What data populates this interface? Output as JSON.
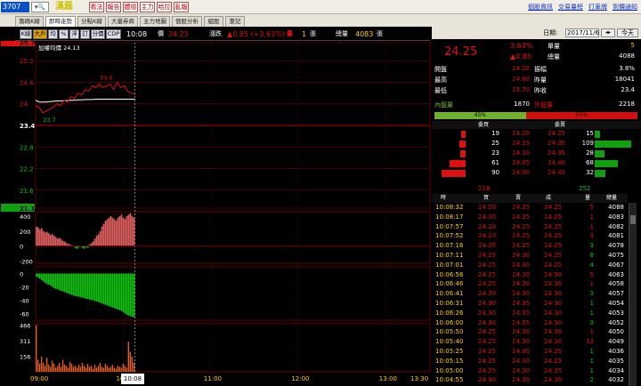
{
  "toolbar": {
    "stock_code": "3707",
    "stock_name": "漢磊",
    "buttons": [
      "看法",
      "報告",
      "體檢",
      "主力",
      "哈拉",
      "亂報"
    ],
    "links": [
      "個股資訊",
      "交易量榜",
      "打車牌",
      "到價通知"
    ]
  },
  "tabs": [
    "籌碼K線",
    "即時走勢",
    "分點K線",
    "大量券商",
    "主力地圖",
    "個股分析",
    "組股",
    "筆記"
  ],
  "active_tab": "即時走勢",
  "chartbar": {
    "buttons": [
      "K線",
      "大戶",
      "均",
      "%",
      "浮",
      "訂",
      "分價",
      "CDP"
    ],
    "on": [
      "大戶"
    ],
    "time": "10:08",
    "price_label": "價",
    "price": "24.25",
    "change_label": "漲跌",
    "change": "▲0.85 (+3.63%)",
    "vol_label": "量",
    "vol": "1",
    "vol_unit": "張",
    "total_label": "總量",
    "total": "4083",
    "total_unit": "張"
  },
  "chart": {
    "avg_label": "加權均價 24.13",
    "y_ticks": [
      "25.7",
      "25.2",
      "24.6",
      "24",
      "23.4",
      "22.8",
      "22.2",
      "21.6",
      "21.1"
    ],
    "high_mark": "24.6",
    "low_mark": "23.7",
    "big_ticks": [
      "400",
      "200",
      "0",
      "-200"
    ],
    "net_ticks": [
      "0",
      "-20",
      "-40",
      "-60"
    ],
    "vol_ticks": [
      "466",
      "311",
      "156"
    ],
    "time_ticks": [
      "09:00",
      "10",
      "11:00",
      "12:00",
      "13:00",
      "13:30"
    ],
    "cursor_time": "10:08",
    "price_line": [
      23.95,
      23.9,
      23.75,
      23.8,
      23.85,
      23.9,
      24.0,
      23.95,
      24.1,
      24.05,
      24.2,
      24.15,
      24.3,
      24.25,
      24.4,
      24.35,
      24.5,
      24.45,
      24.55,
      24.45,
      24.5,
      24.55,
      24.4,
      24.6,
      24.45,
      24.5,
      24.35,
      24.3,
      24.25
    ],
    "avg_line": [
      24.1,
      24.05,
      24.05,
      24.05,
      24.06,
      24.07,
      24.08,
      24.08,
      24.09,
      24.09,
      24.1,
      24.1,
      24.11,
      24.11,
      24.12,
      24.12,
      24.12,
      24.13,
      24.13,
      24.13,
      24.13,
      24.13,
      24.13,
      24.13,
      24.13,
      24.13,
      24.13,
      24.13,
      24.13
    ],
    "big_bars": [
      260,
      250,
      220,
      240,
      200,
      180,
      190,
      170,
      150,
      160,
      140,
      120,
      100,
      110,
      90,
      70,
      60,
      40,
      30,
      20,
      10,
      0,
      -20,
      -30,
      -10,
      0,
      -20,
      -30,
      -10,
      -20,
      20,
      40,
      60,
      100,
      140,
      160,
      200,
      260,
      300,
      340,
      360,
      380,
      400,
      380,
      360,
      340,
      380,
      400,
      420,
      380,
      360,
      400,
      420,
      440,
      400,
      380
    ],
    "net_bars": [
      -5,
      -6,
      -8,
      -10,
      -12,
      -14,
      -16,
      -17,
      -18,
      -20,
      -22,
      -23,
      -24,
      -25,
      -26,
      -27,
      -28,
      -29,
      -30,
      -31,
      -32,
      -33,
      -34,
      -34,
      -35,
      -36,
      -36,
      -37,
      -38,
      -38,
      -39,
      -40,
      -40,
      -41,
      -42,
      -43,
      -44,
      -45,
      -46,
      -47,
      -48,
      -49,
      -50,
      -51,
      -52,
      -53,
      -54,
      -55,
      -56,
      -58,
      -60,
      -62,
      -63,
      -64,
      -65,
      -66
    ],
    "vol_bars": [
      466,
      120,
      80,
      150,
      90,
      60,
      140,
      70,
      50,
      110,
      80,
      40,
      60,
      90,
      50,
      120,
      70,
      60,
      40,
      100,
      80,
      50,
      60,
      40,
      70,
      50,
      90,
      60,
      40,
      80,
      50,
      60,
      30,
      70,
      40,
      60,
      90,
      50,
      40,
      80,
      60,
      40,
      50,
      70,
      40,
      30,
      60,
      50,
      40,
      80,
      60,
      40,
      300,
      200,
      150,
      90
    ],
    "price_min": 21.1,
    "price_max": 25.7
  },
  "right": {
    "date_label": "日期:",
    "date": "2017/11/6",
    "today": "今天",
    "price": "24.25",
    "pct": "3.63%",
    "chg": "▲0.85",
    "single_label": "單量",
    "single": "5",
    "total_label": "總量",
    "total": "4088",
    "rows": [
      {
        "l": "開盤",
        "v": "24.20",
        "l2": "振幅",
        "v2": "3.8%"
      },
      {
        "l": "最高",
        "v": "24.60",
        "l2": "昨量",
        "v2": "18041"
      },
      {
        "l": "最低",
        "v": "23.70",
        "l2": "昨收",
        "v2": "23.4"
      }
    ],
    "inner_label": "內盤量",
    "inner": "1870",
    "outer_label": "外盤量",
    "outer": "2218",
    "buy_pct": "45%",
    "sell_pct": "55%",
    "buy_ratio": 0.45,
    "book_head_buy": "委買",
    "book_head_sell": "委賣",
    "book": [
      {
        "bv": "19",
        "bp": "24.20",
        "sp": "24.25",
        "sv": "15"
      },
      {
        "bv": "25",
        "bp": "24.15",
        "sp": "24.30",
        "sv": "109"
      },
      {
        "bv": "23",
        "bp": "24.10",
        "sp": "24.35",
        "sv": "28"
      },
      {
        "bv": "61",
        "bp": "24.05",
        "sp": "24.40",
        "sv": "68"
      },
      {
        "bv": "90",
        "bp": "24.00",
        "sp": "24.45",
        "sv": "32"
      }
    ],
    "book_buy_bars": [
      0.15,
      0.2,
      0.18,
      0.5,
      0.75
    ],
    "book_sell_bars": [
      0.12,
      0.9,
      0.23,
      0.56,
      0.27
    ],
    "buy_total": "218",
    "sell_total": "252",
    "tick_head": [
      "時",
      "買",
      "賣",
      "成",
      "量",
      "總量"
    ],
    "ticks": [
      [
        "10:08:32",
        "24.20",
        "24.25",
        "24.25",
        "5",
        "4088",
        "r"
      ],
      [
        "10:08:17",
        "24.20",
        "24.25",
        "24.25",
        "1",
        "4083",
        "r"
      ],
      [
        "10:07:57",
        "24.20",
        "24.25",
        "24.25",
        "1",
        "4082",
        "r"
      ],
      [
        "10:07:52",
        "24.20",
        "24.25",
        "24.25",
        "3",
        "4081",
        "r"
      ],
      [
        "10:07:16",
        "24.20",
        "24.25",
        "24.25",
        "3",
        "4078",
        "g"
      ],
      [
        "10:07:11",
        "24.25",
        "24.30",
        "24.25",
        "8",
        "4075",
        "g"
      ],
      [
        "10:07:01",
        "24.25",
        "24.30",
        "24.25",
        "4",
        "4067",
        "g"
      ],
      [
        "10:06:56",
        "24.25",
        "24.30",
        "24.30",
        "5",
        "4063",
        "r"
      ],
      [
        "10:06:46",
        "24.25",
        "24.30",
        "24.30",
        "1",
        "4058",
        "r"
      ],
      [
        "10:06:41",
        "24.30",
        "24.30",
        "24.30",
        "3",
        "4057",
        "g"
      ],
      [
        "10:06:31",
        "24.30",
        "24.35",
        "24.30",
        "1",
        "4054",
        "g"
      ],
      [
        "10:06:26",
        "24.30",
        "24.35",
        "24.30",
        "1",
        "4053",
        "g"
      ],
      [
        "10:06:00",
        "24.30",
        "24.35",
        "24.30",
        "3",
        "4052",
        "g"
      ],
      [
        "10:05:50",
        "24.25",
        "24.30",
        "24.30",
        "1",
        "4050",
        "r"
      ],
      [
        "10:05:40",
        "24.25",
        "24.30",
        "24.30",
        "13",
        "4049",
        "r"
      ],
      [
        "10:05:25",
        "24.25",
        "24.30",
        "24.25",
        "1",
        "4036",
        "g"
      ],
      [
        "10:05:15",
        "24.25",
        "24.30",
        "24.25",
        "1",
        "4035",
        "g"
      ],
      [
        "10:05:00",
        "24.25",
        "24.30",
        "24.25",
        "1",
        "4034",
        "g"
      ],
      [
        "10:04:55",
        "24.30",
        "24.30",
        "24.30",
        "2",
        "4032",
        "g"
      ]
    ]
  }
}
